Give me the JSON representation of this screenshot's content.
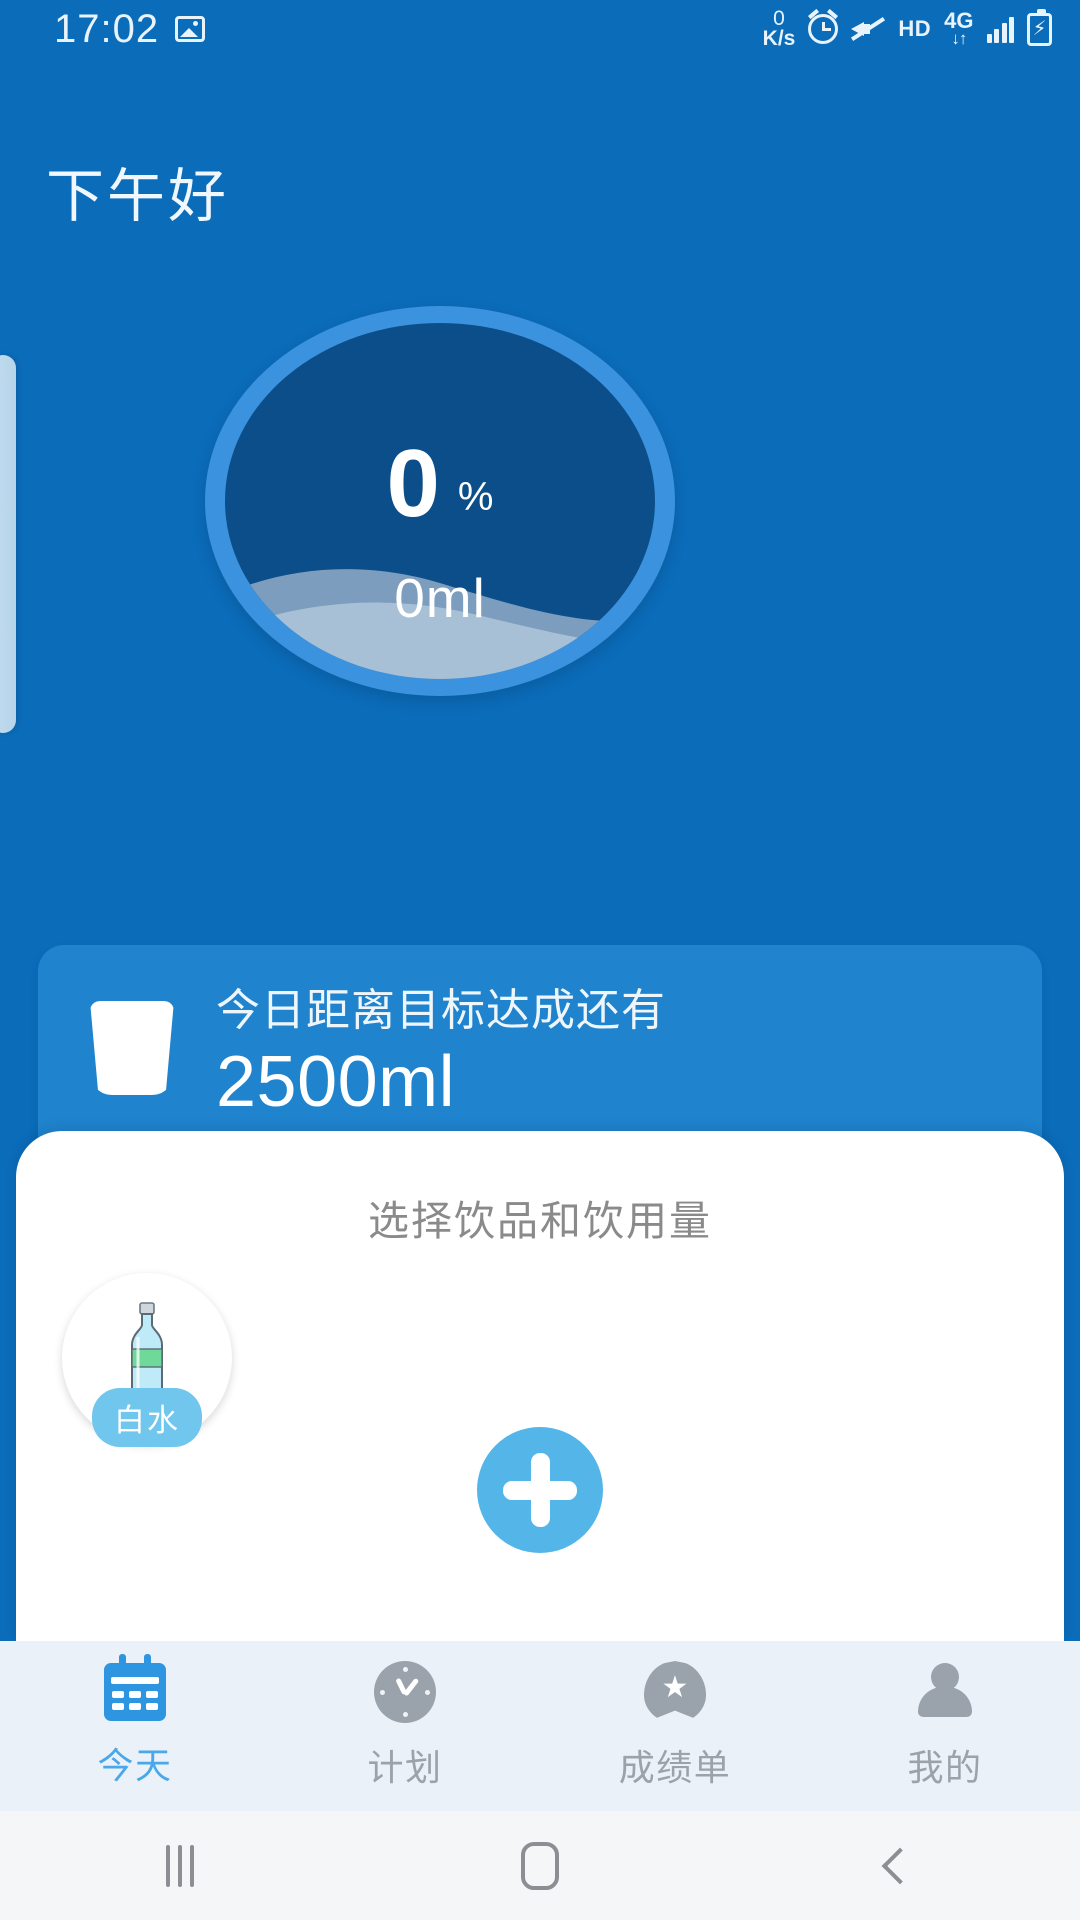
{
  "theme": {
    "bg_blue": "#0b6cba",
    "card_blue": "#1f83ce",
    "ring_blue": "#3b92de",
    "circle_inner": "#0b4e8a",
    "accent_cyan": "#54b6e8",
    "tabbar_bg": "#eaf1f9",
    "tab_active": "#4aa8e8",
    "tab_inactive": "#9aa2ab"
  },
  "status_bar": {
    "time": "17:02",
    "net_speed_value": "0",
    "net_speed_unit": "K/s",
    "hd_label": "HD",
    "network_type": "4G",
    "icons": [
      "photo-icon",
      "alarm-icon",
      "mute-icon",
      "hd-icon",
      "4g-icon",
      "signal-bars-icon",
      "battery-charging-icon"
    ]
  },
  "header": {
    "greeting": "下午好"
  },
  "progress": {
    "percent_value": "0",
    "percent_symbol": "%",
    "volume_text": "0ml"
  },
  "goal_card": {
    "icon": "water-cup-icon",
    "label": "今日距离目标达成还有",
    "value": "2500ml"
  },
  "sheet": {
    "title": "选择饮品和饮用量",
    "drinks": [
      {
        "name": "白水",
        "icon": "water-bottle-icon"
      }
    ],
    "add_button_icon": "plus-icon"
  },
  "tabbar": {
    "items": [
      {
        "label": "今天",
        "icon": "calendar-icon",
        "active": true
      },
      {
        "label": "计划",
        "icon": "clock-icon",
        "active": false
      },
      {
        "label": "成绩单",
        "icon": "badge-star-icon",
        "active": false
      },
      {
        "label": "我的",
        "icon": "person-icon",
        "active": false
      }
    ]
  },
  "system_nav": {
    "recent_label": "recent-apps",
    "home_label": "home",
    "back_label": "back"
  }
}
